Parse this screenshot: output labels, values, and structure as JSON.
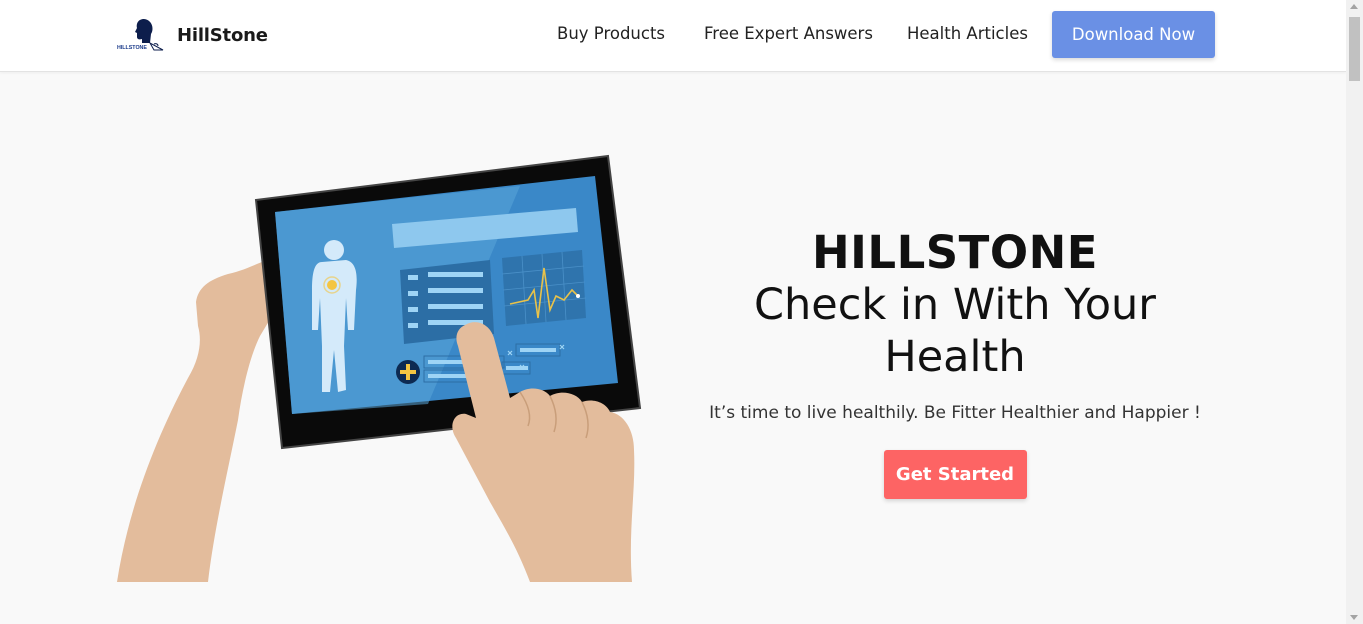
{
  "header": {
    "brand_name": "HillStone",
    "logo_text": "HILLSTONE",
    "nav": {
      "buy_products": "Buy Products",
      "expert_answers": "Free Expert Answers",
      "health_articles": "Health Articles"
    },
    "download_label": "Download Now"
  },
  "hero": {
    "brand": "HILLSTONE",
    "title": "Check in With Your Health",
    "subtitle": "It’s time to live healthily. Be Fitter Healthier and Happier !",
    "cta_label": "Get Started"
  },
  "colors": {
    "primary_button": "#6a90e5",
    "cta_button": "#fd6464",
    "background": "#f9f9f9"
  }
}
